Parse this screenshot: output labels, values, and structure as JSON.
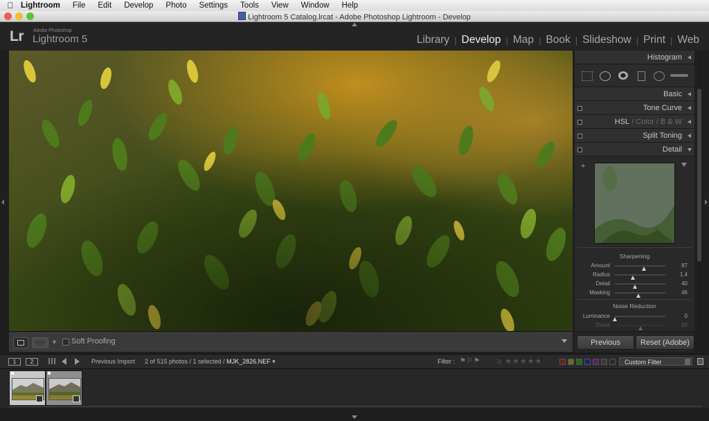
{
  "menubar": {
    "app_name": "Lightroom",
    "items": [
      "File",
      "Edit",
      "Develop",
      "Photo",
      "Settings",
      "Tools",
      "View",
      "Window",
      "Help"
    ]
  },
  "window": {
    "title": "Lightroom 5 Catalog.lrcat - Adobe Photoshop Lightroom - Develop"
  },
  "brand": {
    "logo": "Lr",
    "vendor": "Adobe Photoshop",
    "product": "Lightroom 5"
  },
  "modules": {
    "items": [
      "Library",
      "Develop",
      "Map",
      "Book",
      "Slideshow",
      "Print",
      "Web"
    ],
    "active": "Develop"
  },
  "toolbar": {
    "soft_proofing_label": "Soft Proofing",
    "yy_label": "Y|Y"
  },
  "panels": {
    "histogram": "Histogram",
    "basic": "Basic",
    "tone_curve": "Tone Curve",
    "hsl": "HSL",
    "color": "Color",
    "bw": "B & W",
    "hsl_sep": "/",
    "split_toning": "Split Toning",
    "detail": "Detail"
  },
  "detail": {
    "sharpening_title": "Sharpening",
    "sharpening": [
      {
        "label": "Amount",
        "value": "87",
        "fraction": 0.58
      },
      {
        "label": "Radius",
        "value": "1.4",
        "fraction": 0.36
      },
      {
        "label": "Detail",
        "value": "40",
        "fraction": 0.4
      },
      {
        "label": "Masking",
        "value": "46",
        "fraction": 0.46
      }
    ],
    "noise_title": "Noise Reduction",
    "noise": [
      {
        "label": "Luminance",
        "value": "0",
        "fraction": 0.0
      },
      {
        "label": "Detail",
        "value": "50",
        "fraction": 0.5
      }
    ]
  },
  "buttons": {
    "previous": "Previous",
    "reset": "Reset (Adobe)"
  },
  "filmstrip_bar": {
    "monitor1": "1",
    "monitor2": "2",
    "source": "Previous Import",
    "count": "2 of 515 photos / 1 selected /",
    "filename": "MJK_2826.NEF",
    "filter_label": "Filter :",
    "custom_filter": "Custom Filter"
  },
  "colors": {
    "panel_bg": "#292929",
    "text": "#c7c7c7",
    "active_module": "#f0f0f0"
  }
}
